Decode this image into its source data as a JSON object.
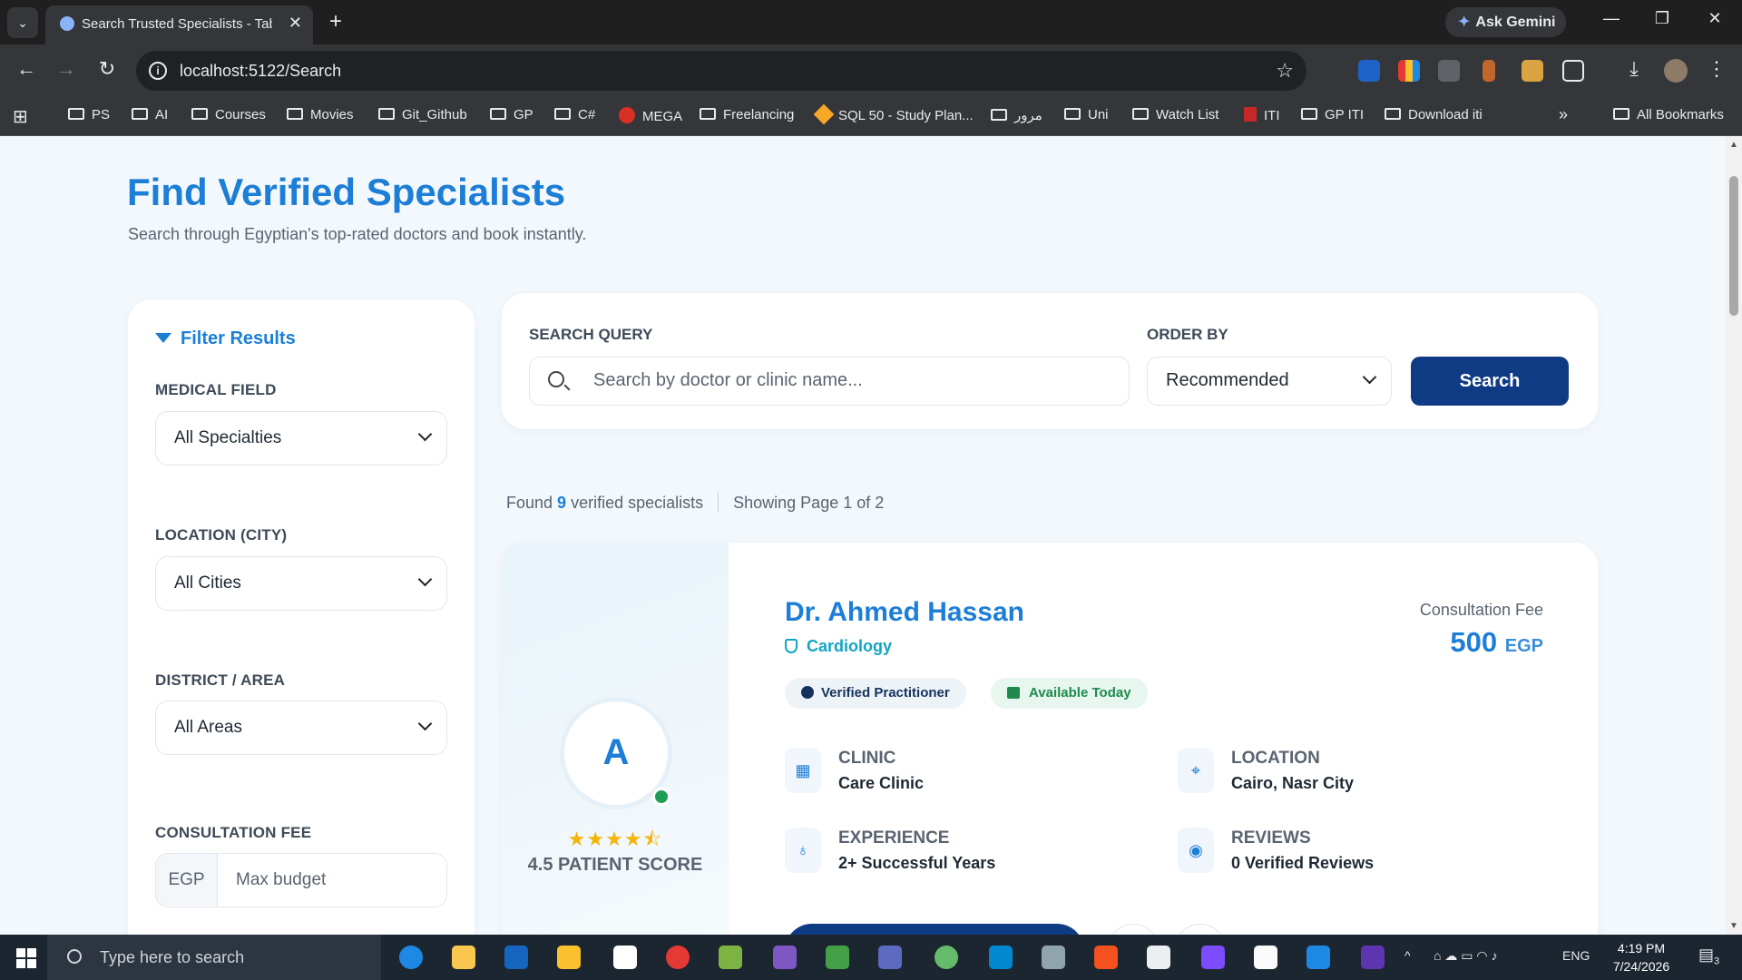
{
  "browser": {
    "tab_title": "Search Trusted Specialists - Tabib",
    "url": "localhost:5122/Search",
    "gemini_label": "Ask Gemini",
    "bookmarks": [
      "PS",
      "AI",
      "Courses",
      "Movies",
      "Git_Github",
      "GP",
      "C#",
      "MEGA",
      "Freelancing",
      "SQL 50 - Study Plan...",
      "مرور",
      "Uni",
      "Watch List",
      "ITI",
      "GP ITI",
      "Download iti"
    ],
    "all_bookmarks": "All Bookmarks"
  },
  "header": {
    "title": "Find Verified Specialists",
    "subtitle": "Search through Egyptian's top-rated doctors and book instantly."
  },
  "filters": {
    "title": "Filter Results",
    "medical_field_label": "MEDICAL FIELD",
    "medical_field_value": "All Specialties",
    "location_label": "LOCATION (CITY)",
    "location_value": "All Cities",
    "district_label": "DISTRICT / AREA",
    "district_value": "All Areas",
    "fee_label": "CONSULTATION FEE",
    "fee_unit": "EGP",
    "fee_placeholder": "Max budget"
  },
  "search": {
    "query_label": "SEARCH QUERY",
    "placeholder": "Search by doctor or clinic name...",
    "order_label": "ORDER BY",
    "order_value": "Recommended",
    "button_label": "Search"
  },
  "results": {
    "found_prefix": "Found ",
    "count": "9",
    "found_suffix": " verified specialists",
    "page_info": "Showing Page 1 of 2"
  },
  "doctor": {
    "initial": "A",
    "rating": 4.5,
    "rating_stars": "★★★★⯪",
    "score_label": "4.5 PATIENT SCORE",
    "name": "Dr. Ahmed Hassan",
    "specialty": "Cardiology",
    "fee_label": "Consultation Fee",
    "fee_amount": "500",
    "fee_currency": "EGP",
    "badge_verified": "Verified Practitioner",
    "badge_available": "Available Today",
    "clinic_label": "CLINIC",
    "clinic_value": "Care Clinic",
    "location_label": "LOCATION",
    "location_value": "Cairo, Nasr City",
    "experience_label": "EXPERIENCE",
    "experience_value": "2+ Successful Years",
    "reviews_label": "REVIEWS",
    "reviews_value": "0 Verified Reviews"
  },
  "taskbar": {
    "search_placeholder": "Type here to search",
    "language": "ENG",
    "time": "4:19 PM",
    "date": "7/24/2026",
    "notification_count": "3"
  }
}
